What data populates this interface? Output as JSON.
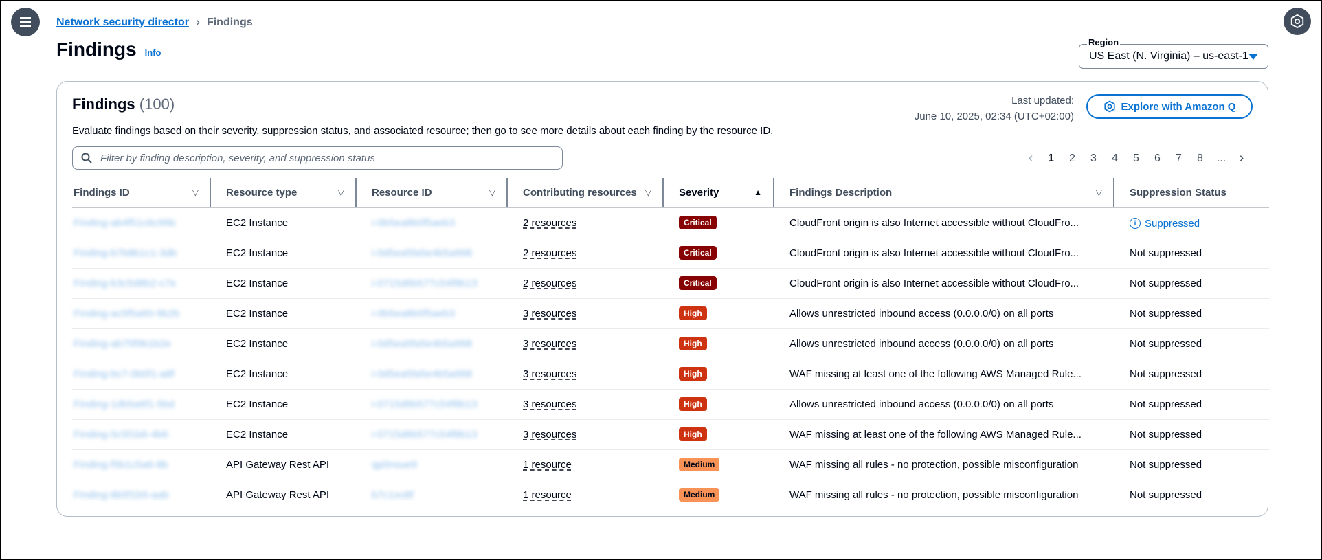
{
  "breadcrumb": {
    "parent": "Network security director",
    "current": "Findings"
  },
  "page": {
    "title": "Findings",
    "info": "Info"
  },
  "region": {
    "label": "Region",
    "value": "US East (N. Virginia) – us-east-1"
  },
  "panel": {
    "title": "Findings",
    "count": "(100)",
    "last_updated_label": "Last updated:",
    "last_updated_value": "June 10, 2025, 02:34 (UTC+02:00)",
    "explore_button": "Explore with Amazon Q",
    "description": "Evaluate findings based on their severity, suppression status, and associated resource; then go to see more details about each finding by the resource ID.",
    "search_placeholder": "Filter by finding description, severity, and suppression status"
  },
  "pagination": {
    "pages": [
      "1",
      "2",
      "3",
      "4",
      "5",
      "6",
      "7",
      "8",
      "..."
    ],
    "current": "1"
  },
  "columns": [
    "Findings ID",
    "Resource type",
    "Resource ID",
    "Contributing resources",
    "Severity",
    "Findings Description",
    "Suppression Status"
  ],
  "rows": [
    {
      "fid": "Finding-ab4f51c6c96b",
      "type": "EC2 Instance",
      "rid": "i-0b5ea8b0f5aeb3",
      "contrib": "2 resources",
      "severity": "Critical",
      "sev_class": "critical",
      "desc": "CloudFront origin is also Internet accessible without CloudFro...",
      "status": "Suppressed"
    },
    {
      "fid": "Finding-b7b8b1c1-3db",
      "type": "EC2 Instance",
      "rid": "i-0d5ea5fa5e4b5a998",
      "contrib": "2 resources",
      "severity": "Critical",
      "sev_class": "critical",
      "desc": "CloudFront origin is also Internet accessible without CloudFro...",
      "status": "Not suppressed"
    },
    {
      "fid": "Finding-b3c5d8b2-c7e",
      "type": "EC2 Instance",
      "rid": "i-0715d6b577c54f8b13",
      "contrib": "2 resources",
      "severity": "Critical",
      "sev_class": "critical",
      "desc": "CloudFront origin is also Internet accessible without CloudFro...",
      "status": "Not suppressed"
    },
    {
      "fid": "Finding-ac5f5a65-9b2b",
      "type": "EC2 Instance",
      "rid": "i-0b5ea8b0f5aeb3",
      "contrib": "3 resources",
      "severity": "High",
      "sev_class": "high",
      "desc": "Allows unrestricted inbound access (0.0.0.0/0) on all ports",
      "status": "Not suppressed"
    },
    {
      "fid": "Finding-ab75f9b1b2e",
      "type": "EC2 Instance",
      "rid": "i-0d5ea5fa5e4b5a998",
      "contrib": "3 resources",
      "severity": "High",
      "sev_class": "high",
      "desc": "Allows unrestricted inbound access (0.0.0.0/0) on all ports",
      "status": "Not suppressed"
    },
    {
      "fid": "Finding-bc7-0b0f1-a8f",
      "type": "EC2 Instance",
      "rid": "i-0d5ea5fa5e4b5a998",
      "contrib": "3 resources",
      "severity": "High",
      "sev_class": "high",
      "desc": "WAF missing at least one of the following AWS Managed Rule...",
      "status": "Not suppressed"
    },
    {
      "fid": "Finding-1db5a6f1-5bd",
      "type": "EC2 Instance",
      "rid": "i-0715d6b577c54f8b13",
      "contrib": "3 resources",
      "severity": "High",
      "sev_class": "high",
      "desc": "Allows unrestricted inbound access (0.0.0.0/0) on all ports",
      "status": "Not suppressed"
    },
    {
      "fid": "Finding-5c5f1b6-4b6",
      "type": "EC2 Instance",
      "rid": "i-0715d6b577c54f8b13",
      "contrib": "3 resources",
      "severity": "High",
      "sev_class": "high",
      "desc": "WAF missing at least one of the following AWS Managed Rule...",
      "status": "Not suppressed"
    },
    {
      "fid": "Finding-f5b1c5a6-8b",
      "type": "API Gateway Rest API",
      "rid": "qp0nsue9",
      "contrib": "1 resource",
      "severity": "Medium",
      "sev_class": "medium",
      "desc": "WAF missing all rules - no protection, possible misconfiguration",
      "status": "Not suppressed"
    },
    {
      "fid": "Finding-8b5f1b5-aab",
      "type": "API Gateway Rest API",
      "rid": "b7c1xo8f",
      "contrib": "1 resource",
      "severity": "Medium",
      "sev_class": "medium",
      "desc": "WAF missing all rules - no protection, possible misconfiguration",
      "status": "Not suppressed"
    }
  ]
}
